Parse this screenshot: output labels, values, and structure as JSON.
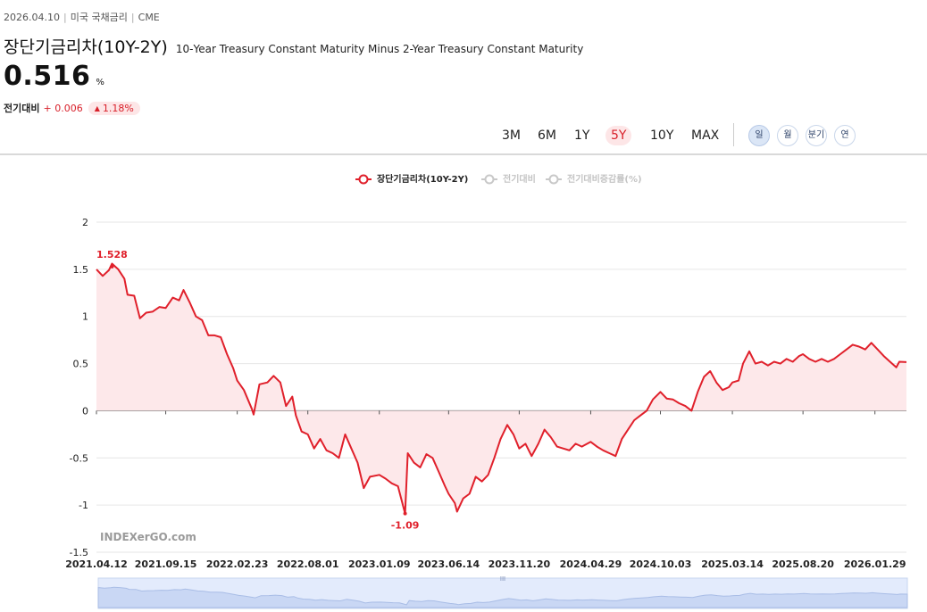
{
  "meta": {
    "date": "2026.04.10",
    "category": "미국 국채금리",
    "source": "CME"
  },
  "title": {
    "korean": "장단기금리차(10Y-2Y)",
    "english": "10-Year Treasury Constant Maturity Minus 2-Year Treasury Constant Maturity"
  },
  "value": {
    "current": "0.516",
    "unit": "%"
  },
  "change": {
    "label": "전기대비",
    "absolute": "+ 0.006",
    "percent": "1.18%",
    "direction": "up"
  },
  "ranges": [
    "3M",
    "6M",
    "1Y",
    "5Y",
    "10Y",
    "MAX"
  ],
  "active_range": "5Y",
  "periods": [
    "일",
    "월",
    "분기",
    "연"
  ],
  "active_period": "일",
  "watermark": "INDEXerGO.com",
  "colors": {
    "accent": "#e0202b",
    "area_fill": "#fde8ea",
    "navigator": "#dfe8fb"
  },
  "legend": [
    {
      "label": "장단기금리차(10Y-2Y)",
      "active": true
    },
    {
      "label": "전기대비",
      "active": false
    },
    {
      "label": "전기대비증감률(%)",
      "active": false
    }
  ],
  "chart_data": {
    "type": "area",
    "series": [
      {
        "name": "장단기금리차(10Y-2Y)",
        "points": [
          [
            "2021-04-12",
            1.5
          ],
          [
            "2021-04-26",
            1.43
          ],
          [
            "2021-05-10",
            1.49
          ],
          [
            "2021-05-17",
            1.56
          ],
          [
            "2021-05-31",
            1.5
          ],
          [
            "2021-06-14",
            1.4
          ],
          [
            "2021-06-21",
            1.23
          ],
          [
            "2021-07-06",
            1.22
          ],
          [
            "2021-07-19",
            0.98
          ],
          [
            "2021-08-02",
            1.04
          ],
          [
            "2021-08-16",
            1.05
          ],
          [
            "2021-09-01",
            1.1
          ],
          [
            "2021-09-15",
            1.09
          ],
          [
            "2021-10-01",
            1.2
          ],
          [
            "2021-10-15",
            1.17
          ],
          [
            "2021-10-25",
            1.28
          ],
          [
            "2021-11-08",
            1.15
          ],
          [
            "2021-11-22",
            1.0
          ],
          [
            "2021-12-06",
            0.96
          ],
          [
            "2021-12-20",
            0.8
          ],
          [
            "2022-01-03",
            0.8
          ],
          [
            "2022-01-17",
            0.78
          ],
          [
            "2022-01-31",
            0.6
          ],
          [
            "2022-02-14",
            0.45
          ],
          [
            "2022-02-23",
            0.32
          ],
          [
            "2022-03-10",
            0.22
          ],
          [
            "2022-03-28",
            0.02
          ],
          [
            "2022-04-01",
            -0.04
          ],
          [
            "2022-04-14",
            0.28
          ],
          [
            "2022-05-02",
            0.3
          ],
          [
            "2022-05-16",
            0.37
          ],
          [
            "2022-05-31",
            0.3
          ],
          [
            "2022-06-13",
            0.05
          ],
          [
            "2022-06-27",
            0.15
          ],
          [
            "2022-07-05",
            -0.05
          ],
          [
            "2022-07-18",
            -0.22
          ],
          [
            "2022-08-01",
            -0.25
          ],
          [
            "2022-08-15",
            -0.4
          ],
          [
            "2022-08-29",
            -0.3
          ],
          [
            "2022-09-12",
            -0.42
          ],
          [
            "2022-09-26",
            -0.45
          ],
          [
            "2022-10-10",
            -0.5
          ],
          [
            "2022-10-24",
            -0.25
          ],
          [
            "2022-11-07",
            -0.4
          ],
          [
            "2022-11-21",
            -0.55
          ],
          [
            "2022-12-05",
            -0.82
          ],
          [
            "2022-12-19",
            -0.7
          ],
          [
            "2023-01-09",
            -0.68
          ],
          [
            "2023-01-23",
            -0.72
          ],
          [
            "2023-02-06",
            -0.77
          ],
          [
            "2023-02-20",
            -0.8
          ],
          [
            "2023-03-08",
            -1.09
          ],
          [
            "2023-03-14",
            -0.45
          ],
          [
            "2023-03-28",
            -0.55
          ],
          [
            "2023-04-11",
            -0.6
          ],
          [
            "2023-04-25",
            -0.46
          ],
          [
            "2023-05-09",
            -0.5
          ],
          [
            "2023-05-23",
            -0.65
          ],
          [
            "2023-06-06",
            -0.8
          ],
          [
            "2023-06-14",
            -0.88
          ],
          [
            "2023-06-28",
            -0.98
          ],
          [
            "2023-07-03",
            -1.07
          ],
          [
            "2023-07-17",
            -0.93
          ],
          [
            "2023-07-31",
            -0.88
          ],
          [
            "2023-08-14",
            -0.7
          ],
          [
            "2023-08-28",
            -0.75
          ],
          [
            "2023-09-11",
            -0.68
          ],
          [
            "2023-09-25",
            -0.5
          ],
          [
            "2023-10-09",
            -0.3
          ],
          [
            "2023-10-24",
            -0.15
          ],
          [
            "2023-11-07",
            -0.25
          ],
          [
            "2023-11-20",
            -0.4
          ],
          [
            "2023-12-04",
            -0.35
          ],
          [
            "2023-12-18",
            -0.48
          ],
          [
            "2024-01-02",
            -0.35
          ],
          [
            "2024-01-16",
            -0.2
          ],
          [
            "2024-01-30",
            -0.28
          ],
          [
            "2024-02-13",
            -0.38
          ],
          [
            "2024-02-27",
            -0.4
          ],
          [
            "2024-03-12",
            -0.42
          ],
          [
            "2024-03-26",
            -0.35
          ],
          [
            "2024-04-09",
            -0.38
          ],
          [
            "2024-04-29",
            -0.33
          ],
          [
            "2024-05-13",
            -0.38
          ],
          [
            "2024-05-27",
            -0.42
          ],
          [
            "2024-06-10",
            -0.45
          ],
          [
            "2024-06-24",
            -0.48
          ],
          [
            "2024-07-08",
            -0.3
          ],
          [
            "2024-07-22",
            -0.2
          ],
          [
            "2024-08-05",
            -0.1
          ],
          [
            "2024-08-19",
            -0.05
          ],
          [
            "2024-09-02",
            0.0
          ],
          [
            "2024-09-16",
            0.12
          ],
          [
            "2024-10-03",
            0.2
          ],
          [
            "2024-10-17",
            0.13
          ],
          [
            "2024-10-31",
            0.12
          ],
          [
            "2024-11-14",
            0.08
          ],
          [
            "2024-11-28",
            0.05
          ],
          [
            "2024-12-12",
            0.0
          ],
          [
            "2024-12-26",
            0.2
          ],
          [
            "2025-01-09",
            0.36
          ],
          [
            "2025-01-23",
            0.42
          ],
          [
            "2025-02-06",
            0.3
          ],
          [
            "2025-02-20",
            0.22
          ],
          [
            "2025-03-06",
            0.25
          ],
          [
            "2025-03-14",
            0.3
          ],
          [
            "2025-03-28",
            0.32
          ],
          [
            "2025-04-07",
            0.5
          ],
          [
            "2025-04-21",
            0.63
          ],
          [
            "2025-05-05",
            0.5
          ],
          [
            "2025-05-19",
            0.52
          ],
          [
            "2025-06-02",
            0.48
          ],
          [
            "2025-06-16",
            0.52
          ],
          [
            "2025-06-30",
            0.5
          ],
          [
            "2025-07-14",
            0.55
          ],
          [
            "2025-07-28",
            0.52
          ],
          [
            "2025-08-11",
            0.58
          ],
          [
            "2025-08-20",
            0.6
          ],
          [
            "2025-09-03",
            0.55
          ],
          [
            "2025-09-17",
            0.52
          ],
          [
            "2025-10-01",
            0.55
          ],
          [
            "2025-10-15",
            0.52
          ],
          [
            "2025-10-29",
            0.55
          ],
          [
            "2025-11-12",
            0.6
          ],
          [
            "2025-11-26",
            0.65
          ],
          [
            "2025-12-10",
            0.7
          ],
          [
            "2025-12-24",
            0.68
          ],
          [
            "2026-01-07",
            0.65
          ],
          [
            "2026-01-21",
            0.72
          ],
          [
            "2026-02-04",
            0.65
          ],
          [
            "2026-02-18",
            0.58
          ],
          [
            "2026-03-04",
            0.52
          ],
          [
            "2026-03-18",
            0.46
          ],
          [
            "2026-03-25",
            0.52
          ],
          [
            "2026-04-10",
            0.516
          ]
        ]
      }
    ],
    "x_tick_labels": [
      "2021.04.12",
      "2021.09.15",
      "2022.02.23",
      "2022.08.01",
      "2023.01.09",
      "2023.06.14",
      "2023.11.20",
      "2024.04.29",
      "2024.10.03",
      "2025.03.14",
      "2025.08.20",
      "2026.01.29"
    ],
    "y_ticks": [
      2,
      1.5,
      1,
      0.5,
      0,
      -0.5,
      -1,
      -1.5
    ],
    "ylim": [
      -1.5,
      2
    ],
    "annotations": [
      {
        "label": "1.528",
        "x": "2021-05-17",
        "y": 1.528
      },
      {
        "label": "-1.09",
        "x": "2023-03-08",
        "y": -1.09
      }
    ],
    "grid": true,
    "legend_position": "top-center"
  }
}
